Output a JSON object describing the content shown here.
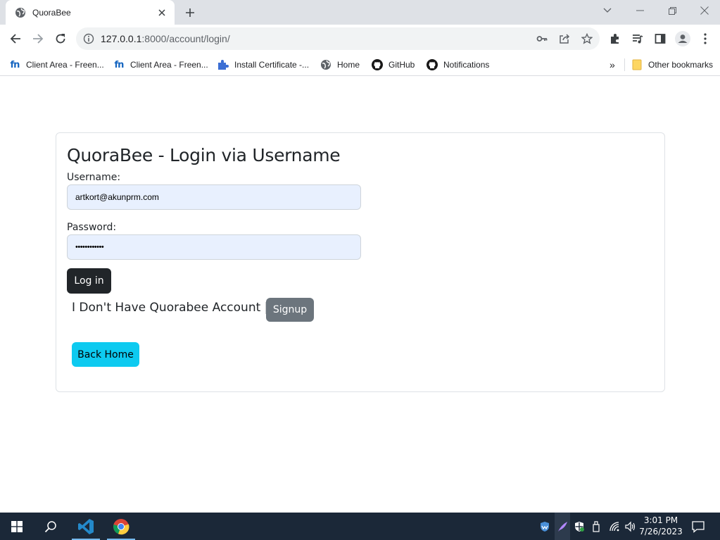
{
  "browser": {
    "tab": {
      "title": "QuoraBee",
      "favicon": "globe-icon"
    },
    "address": {
      "host": "127.0.0.1",
      "path": ":8000/account/login/"
    },
    "bookmarks": [
      {
        "label": "Client Area - Freen...",
        "icon": "fn-logo"
      },
      {
        "label": "Client Area - Freen...",
        "icon": "fn-logo"
      },
      {
        "label": "Install Certificate -...",
        "icon": "puzzle-icon"
      },
      {
        "label": "Home",
        "icon": "globe-icon"
      },
      {
        "label": "GitHub",
        "icon": "github-icon"
      },
      {
        "label": "Notifications",
        "icon": "github-icon"
      }
    ],
    "fn_text": "fn",
    "overflow": "»",
    "other_bookmarks": "Other bookmarks"
  },
  "login": {
    "heading": "QuoraBee - Login via Username",
    "username_label": "Username:",
    "username_value": "artkort@akunprm.com",
    "password_label": "Password:",
    "password_value": "••••••••••••",
    "login_button": "Log in",
    "no_account_text": "I Don't Have Quorabee Account |",
    "signup_button": "Signup",
    "back_home_button": "Back Home"
  },
  "colors": {
    "login_btn": "#212529",
    "signup_btn": "#6c757d",
    "home_btn": "#0dcaf0",
    "autofill": "#e8f0fe"
  },
  "taskbar": {
    "time": "3:01 PM",
    "date": "7/26/2023"
  }
}
